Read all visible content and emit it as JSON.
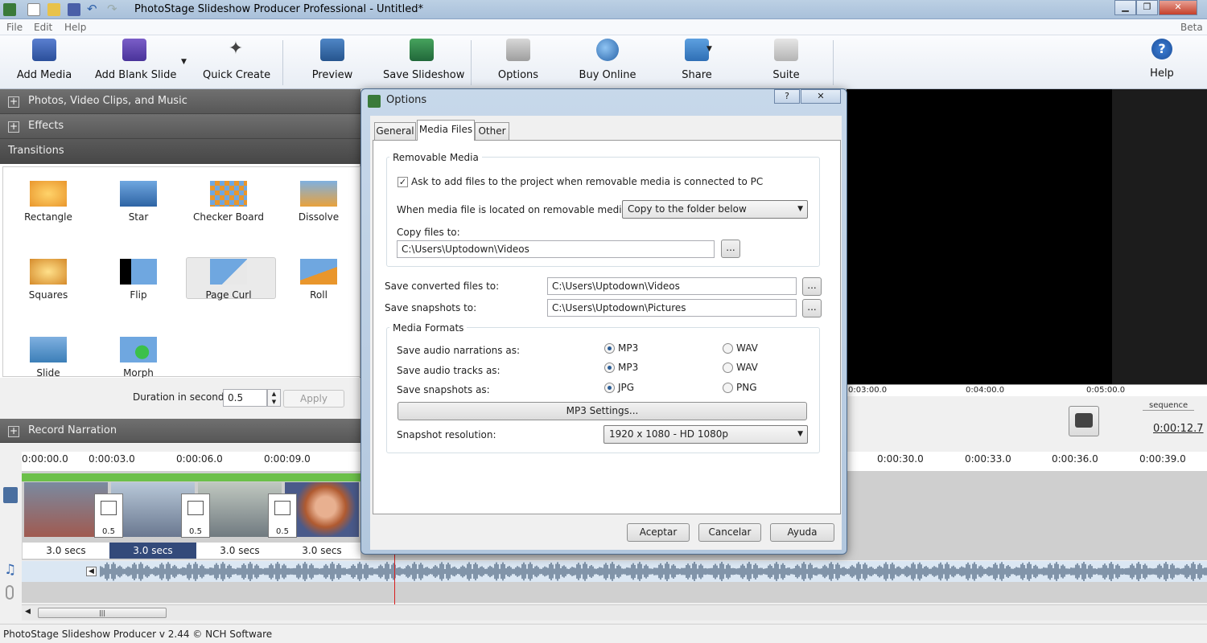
{
  "window": {
    "title": "PhotoStage Slideshow Producer Professional - Untitled*"
  },
  "menu": [
    "File",
    "Edit",
    "Help"
  ],
  "menu_right": "Beta",
  "toolbar": {
    "add_media": "Add Media",
    "add_blank_slide": "Add Blank Slide",
    "quick_create": "Quick Create",
    "preview": "Preview",
    "save_slideshow": "Save Slideshow",
    "options": "Options",
    "buy_online": "Buy Online",
    "share": "Share",
    "suite": "Suite",
    "help": "Help"
  },
  "sections": {
    "photos": "Photos, Video Clips, and Music",
    "effects": "Effects",
    "transitions": "Transitions",
    "record_narration": "Record Narration"
  },
  "transitions": [
    {
      "label": "Rectangle",
      "icon": "rectangle-transition-icon"
    },
    {
      "label": "Star",
      "icon": "star-transition-icon"
    },
    {
      "label": "Checker Board",
      "icon": "checker-board-transition-icon"
    },
    {
      "label": "Dissolve",
      "icon": "dissolve-transition-icon"
    },
    {
      "label": "Squares",
      "icon": "squares-transition-icon"
    },
    {
      "label": "Flip",
      "icon": "flip-transition-icon"
    },
    {
      "label": "Page Curl",
      "icon": "page-curl-transition-icon"
    },
    {
      "label": "Roll",
      "icon": "roll-transition-icon"
    },
    {
      "label": "Slide",
      "icon": "slide-transition-icon"
    },
    {
      "label": "Morph",
      "icon": "morph-transition-icon"
    }
  ],
  "duration": {
    "label": "Duration in seconds:",
    "value": "0.5",
    "apply": "Apply"
  },
  "preview": {
    "ticks": [
      "0:03:00.0",
      "0:04:00.0",
      "0:05:00.0"
    ],
    "sequence_label": "sequence",
    "time": "0:00:12.7"
  },
  "timeline": {
    "ticks": [
      "0:00:00.0",
      "0:00:03.0",
      "0:00:06.0",
      "0:00:09.0",
      "0:00:30.0",
      "0:00:33.0",
      "0:00:36.0",
      "0:00:39.0"
    ],
    "clips": [
      "3.0 secs",
      "3.0 secs",
      "3.0 secs",
      "3.0 secs"
    ],
    "transition_durations": [
      "0.5",
      "0.5",
      "0.5"
    ]
  },
  "status": "PhotoStage Slideshow Producer v 2.44 © NCH Software",
  "dialog": {
    "title": "Options",
    "help_btn": "?",
    "close_btn": "✕",
    "tabs": [
      "General",
      "Media Files",
      "Other"
    ],
    "active_tab": "Media Files",
    "removable_media": {
      "title": "Removable Media",
      "ask_label": "Ask to add files to the project when removable media is connected to PC",
      "ask_checked": true,
      "when_label": "When media file is located on removable media:",
      "when_value": "Copy to the folder below",
      "copy_label": "Copy files to:",
      "copy_value": "C:\\Users\\Uptodown\\Videos"
    },
    "converted_label": "Save converted files to:",
    "converted_value": "C:\\Users\\Uptodown\\Videos",
    "snapshots_label": "Save snapshots to:",
    "snapshots_value": "C:\\Users\\Uptodown\\Pictures",
    "browse": "...",
    "media_formats": {
      "title": "Media Formats",
      "narrations_label": "Save audio narrations as:",
      "tracks_label": "Save audio tracks as:",
      "snapshots_label": "Save snapshots as:",
      "mp3": "MP3",
      "wav": "WAV",
      "jpg": "JPG",
      "png": "PNG",
      "mp3_settings": "MP3 Settings...",
      "resolution_label": "Snapshot resolution:",
      "resolution_value": "1920 x 1080 - HD 1080p"
    },
    "ok": "Aceptar",
    "cancel": "Cancelar",
    "help": "Ayuda"
  }
}
